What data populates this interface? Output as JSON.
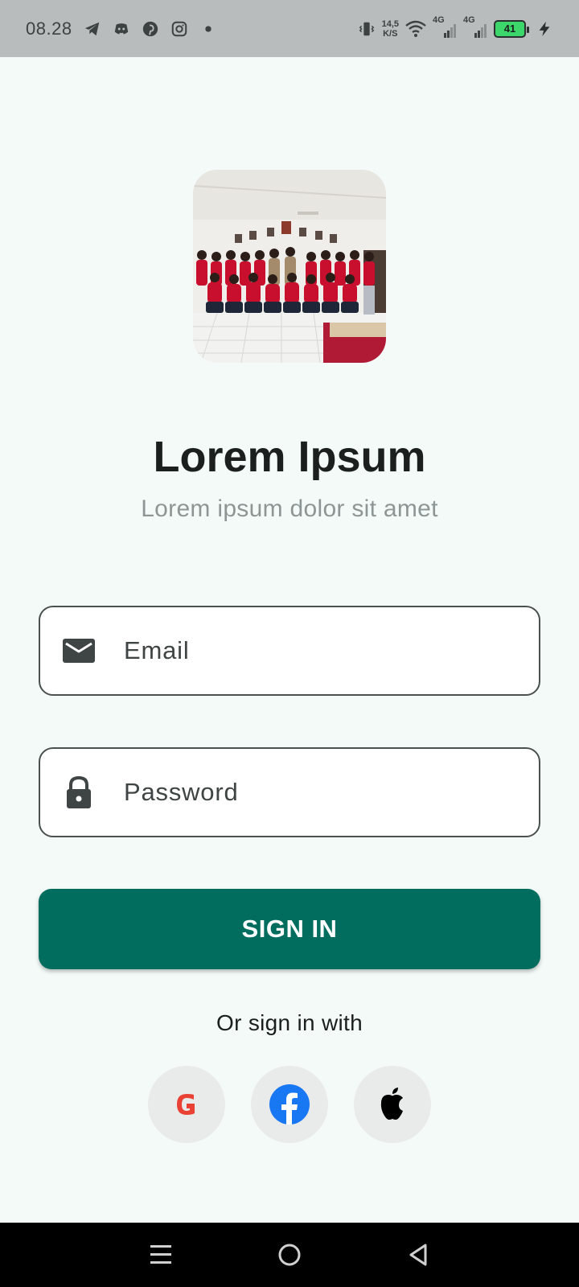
{
  "status_bar": {
    "time": "08.28",
    "net_speed_value": "14,5",
    "net_speed_unit": "K/S",
    "sim1_label": "4G",
    "sim2_label": "4G",
    "battery_level": "41",
    "left_icons": [
      "telegram-icon",
      "discord-icon",
      "pinterest-icon",
      "instagram-icon",
      "notification-dot-icon"
    ],
    "right_icons": [
      "vibrate-icon",
      "wifi-icon",
      "signal-icon",
      "signal-icon",
      "battery-icon",
      "charging-icon"
    ]
  },
  "app": {
    "title": "Lorem Ipsum",
    "subtitle": "Lorem ipsum dolor sit amet",
    "logo": "group-photo"
  },
  "form": {
    "email_placeholder": "Email",
    "email_value": "",
    "password_placeholder": "Password",
    "password_value": "",
    "signin_label": "SIGN IN"
  },
  "social": {
    "or_text": "Or sign in with",
    "providers": [
      "google-icon",
      "facebook-icon",
      "apple-icon"
    ]
  },
  "nav_bar": {
    "buttons": [
      "menu-icon",
      "home-icon",
      "back-icon"
    ]
  },
  "colors": {
    "background": "#f4faf8",
    "primary": "#006d5f",
    "status_bar": "#b9bcbc",
    "battery_fill": "#3dd66b",
    "google_red": "#e94235",
    "facebook_blue": "#1877f2"
  }
}
